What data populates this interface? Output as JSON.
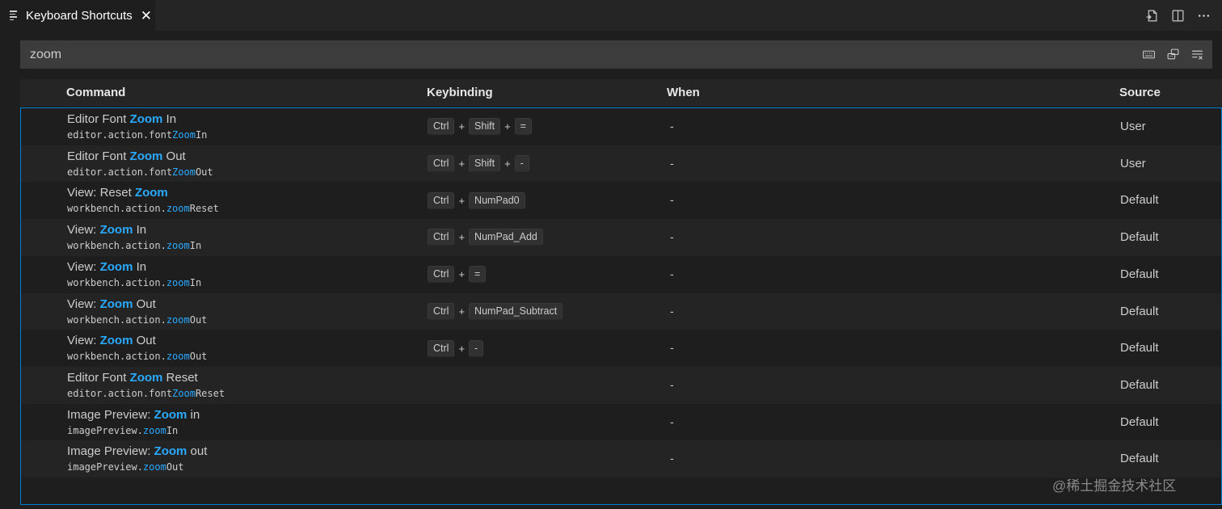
{
  "tab": {
    "title": "Keyboard Shortcuts",
    "close": "✕"
  },
  "header_actions": [
    "open-json-icon",
    "split-editor-icon",
    "more-actions-icon"
  ],
  "search": {
    "value": "zoom",
    "actions": [
      "record-keys-icon",
      "sort-by-precedence-icon",
      "clear-input-icon"
    ]
  },
  "columns": {
    "command": "Command",
    "keybinding": "Keybinding",
    "when": "When",
    "source": "Source"
  },
  "rows": [
    {
      "title": [
        "Editor Font ",
        "Zoom",
        " In"
      ],
      "id": [
        "editor.action.font",
        "Zoom",
        "In"
      ],
      "keys": [
        "Ctrl",
        "Shift",
        "="
      ],
      "when": "-",
      "source": "User"
    },
    {
      "title": [
        "Editor Font ",
        "Zoom",
        " Out"
      ],
      "id": [
        "editor.action.font",
        "Zoom",
        "Out"
      ],
      "keys": [
        "Ctrl",
        "Shift",
        "-"
      ],
      "when": "-",
      "source": "User"
    },
    {
      "title": [
        "View: Reset ",
        "Zoom",
        ""
      ],
      "id": [
        "workbench.action.",
        "zoom",
        "Reset"
      ],
      "keys": [
        "Ctrl",
        "NumPad0"
      ],
      "when": "-",
      "source": "Default"
    },
    {
      "title": [
        "View: ",
        "Zoom",
        " In"
      ],
      "id": [
        "workbench.action.",
        "zoom",
        "In"
      ],
      "keys": [
        "Ctrl",
        "NumPad_Add"
      ],
      "when": "-",
      "source": "Default"
    },
    {
      "title": [
        "View: ",
        "Zoom",
        " In"
      ],
      "id": [
        "workbench.action.",
        "zoom",
        "In"
      ],
      "keys": [
        "Ctrl",
        "="
      ],
      "when": "-",
      "source": "Default"
    },
    {
      "title": [
        "View: ",
        "Zoom",
        " Out"
      ],
      "id": [
        "workbench.action.",
        "zoom",
        "Out"
      ],
      "keys": [
        "Ctrl",
        "NumPad_Subtract"
      ],
      "when": "-",
      "source": "Default"
    },
    {
      "title": [
        "View: ",
        "Zoom",
        " Out"
      ],
      "id": [
        "workbench.action.",
        "zoom",
        "Out"
      ],
      "keys": [
        "Ctrl",
        "-"
      ],
      "when": "-",
      "source": "Default"
    },
    {
      "title": [
        "Editor Font ",
        "Zoom",
        " Reset"
      ],
      "id": [
        "editor.action.font",
        "Zoom",
        "Reset"
      ],
      "keys": [],
      "when": "-",
      "source": "Default"
    },
    {
      "title": [
        "Image Preview: ",
        "Zoom",
        " in"
      ],
      "id": [
        "imagePreview.",
        "zoom",
        "In"
      ],
      "keys": [],
      "when": "-",
      "source": "Default"
    },
    {
      "title": [
        "Image Preview: ",
        "Zoom",
        " out"
      ],
      "id": [
        "imagePreview.",
        "zoom",
        "Out"
      ],
      "keys": [],
      "when": "-",
      "source": "Default"
    }
  ],
  "watermark": "@稀土掘金技术社区",
  "colors": {
    "highlight": "#2aaaff",
    "focus_border": "#007fd4",
    "background": "#1e1e1e"
  }
}
